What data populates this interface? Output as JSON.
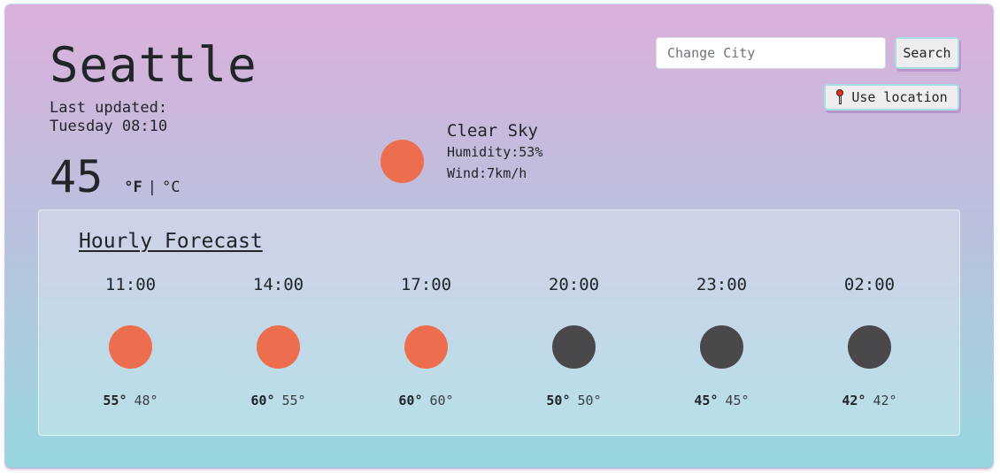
{
  "current": {
    "city": "Seattle",
    "last_updated_label": "Last updated:",
    "last_updated_value": "Tuesday 08:10",
    "temperature": "45",
    "unit_f": "°F",
    "unit_separator": "|",
    "unit_c": "°C",
    "condition_icon": "sun-icon",
    "condition": "Clear Sky",
    "humidity": "Humidity:53%",
    "wind": "Wind:7km/h"
  },
  "colors": {
    "sun": "#ed6e4e",
    "moon": "#4a484b",
    "gradient_top": "#dbb0da",
    "gradient_bottom": "#96d6df"
  },
  "search": {
    "placeholder": "Change City",
    "value": "",
    "button_label": "Search"
  },
  "location": {
    "icon": "round-pushpin-icon",
    "button_label": "Use location"
  },
  "forecast": {
    "title": "Hourly Forecast",
    "hours": [
      {
        "time": "11:00",
        "icon": "sun-icon",
        "high": "55°",
        "low": "48°"
      },
      {
        "time": "14:00",
        "icon": "sun-icon",
        "high": "60°",
        "low": "55°"
      },
      {
        "time": "17:00",
        "icon": "sun-icon",
        "high": "60°",
        "low": "60°"
      },
      {
        "time": "20:00",
        "icon": "moon-icon",
        "high": "50°",
        "low": "50°"
      },
      {
        "time": "23:00",
        "icon": "moon-icon",
        "high": "45°",
        "low": "45°"
      },
      {
        "time": "02:00",
        "icon": "moon-icon",
        "high": "42°",
        "low": "42°"
      }
    ]
  }
}
